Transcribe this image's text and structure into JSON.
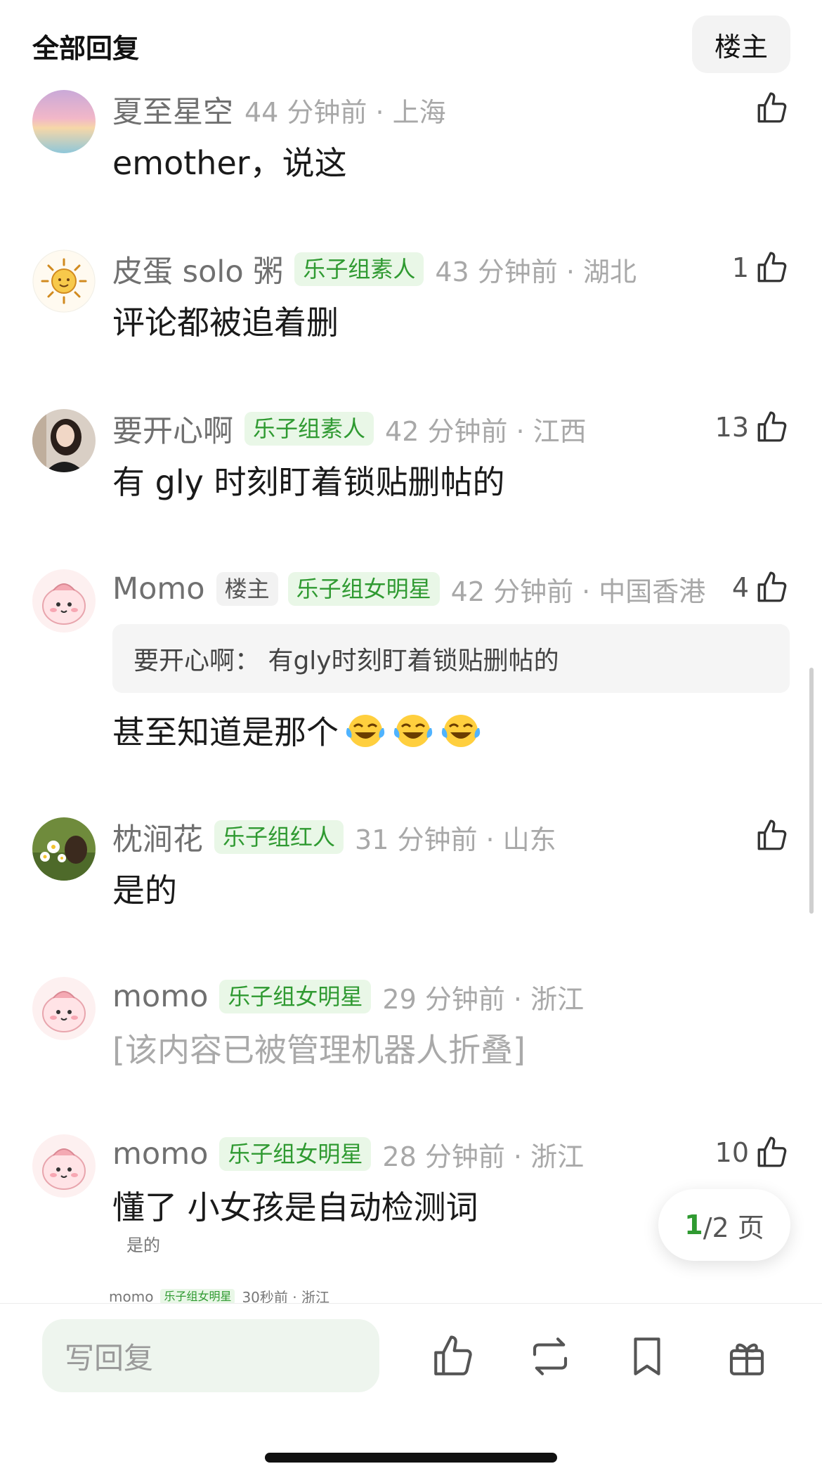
{
  "header": {
    "title": "全部回复",
    "filter_label": "楼主"
  },
  "comments": [
    {
      "username": "夏至星空",
      "badge": "",
      "time": "44 分钟前 · 上海",
      "likes": "",
      "text": "emother，说这"
    },
    {
      "username": "皮蛋 solo 粥",
      "badge": "乐子组素人",
      "time": "43 分钟前 · 湖北",
      "likes": "1",
      "text": "评论都被追着删"
    },
    {
      "username": "要开心啊",
      "badge": "乐子组素人",
      "time": "42 分钟前 · 江西",
      "likes": "13",
      "text": "有 gly 时刻盯着锁贴删帖的"
    },
    {
      "username": "Momo",
      "op_badge": "楼主",
      "badge": "乐子组女明星",
      "time": "42 分钟前 · 中国香港",
      "likes": "4",
      "quote": "要开心啊：  有gly时刻盯着锁贴删帖的",
      "text": "甚至知道是那个"
    },
    {
      "username": "枕涧花",
      "badge": "乐子组红人",
      "time": "31 分钟前 · 山东",
      "likes": "",
      "text": "是的"
    },
    {
      "username": "momo",
      "badge": "乐子组女明星",
      "time": "29 分钟前 · 浙江",
      "likes": "",
      "text": "[该内容已被管理机器人折叠]"
    },
    {
      "username": "momo",
      "badge": "乐子组女明星",
      "time": "28 分钟前 · 浙江",
      "likes": "10",
      "text": "懂了 小女孩是自动检测词"
    }
  ],
  "pager": {
    "current": "1",
    "total_label": "/2 页"
  },
  "peek": {
    "top_text": "是的",
    "username": "momo",
    "badge": "乐子组女明星",
    "time": "30秒前 · 浙江"
  },
  "bottom_bar": {
    "reply_placeholder": "写回复"
  },
  "icons": [
    "thumbs-up-icon",
    "repost-icon",
    "bookmark-icon",
    "gift-icon"
  ],
  "colors": {
    "accent_green": "#2f9a31",
    "badge_bg": "#e9f7e7"
  }
}
